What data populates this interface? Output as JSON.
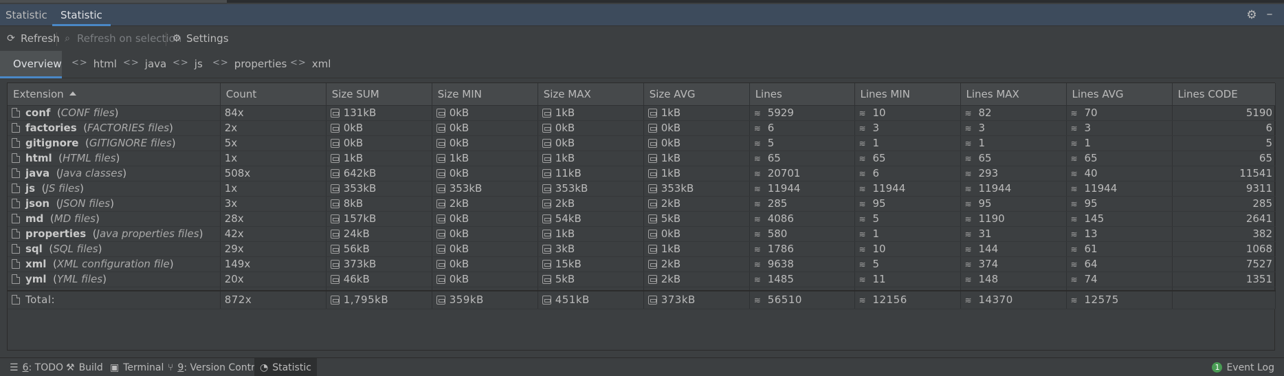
{
  "window": {
    "title": "Statistic",
    "active_tab": "Statistic"
  },
  "toolbar": {
    "refresh": "Refresh",
    "refresh_on_selection": "Refresh on selection",
    "settings": "Settings"
  },
  "subtabs": [
    "Overview",
    "html",
    "java",
    "js",
    "properties",
    "xml"
  ],
  "table": {
    "columns": [
      "Extension",
      "Count",
      "Size SUM",
      "Size MIN",
      "Size MAX",
      "Size AVG",
      "Lines",
      "Lines MIN",
      "Lines MAX",
      "Lines AVG",
      "Lines CODE"
    ],
    "rows": [
      {
        "name": "conf",
        "desc": "CONF files",
        "count": "84x",
        "size_sum": "131kB",
        "size_min": "0kB",
        "size_max": "1kB",
        "size_avg": "1kB",
        "lines": "5929",
        "lines_min": "10",
        "lines_max": "82",
        "lines_avg": "70",
        "lines_code": "5190"
      },
      {
        "name": "factories",
        "desc": "FACTORIES files",
        "count": "2x",
        "size_sum": "0kB",
        "size_min": "0kB",
        "size_max": "0kB",
        "size_avg": "0kB",
        "lines": "6",
        "lines_min": "3",
        "lines_max": "3",
        "lines_avg": "3",
        "lines_code": "6"
      },
      {
        "name": "gitignore",
        "desc": "GITIGNORE files",
        "count": "5x",
        "size_sum": "0kB",
        "size_min": "0kB",
        "size_max": "0kB",
        "size_avg": "0kB",
        "lines": "5",
        "lines_min": "1",
        "lines_max": "1",
        "lines_avg": "1",
        "lines_code": "5"
      },
      {
        "name": "html",
        "desc": "HTML files",
        "count": "1x",
        "size_sum": "1kB",
        "size_min": "1kB",
        "size_max": "1kB",
        "size_avg": "1kB",
        "lines": "65",
        "lines_min": "65",
        "lines_max": "65",
        "lines_avg": "65",
        "lines_code": "65"
      },
      {
        "name": "java",
        "desc": "Java classes",
        "count": "508x",
        "size_sum": "642kB",
        "size_min": "0kB",
        "size_max": "11kB",
        "size_avg": "1kB",
        "lines": "20701",
        "lines_min": "6",
        "lines_max": "293",
        "lines_avg": "40",
        "lines_code": "11541"
      },
      {
        "name": "js",
        "desc": "JS files",
        "count": "1x",
        "size_sum": "353kB",
        "size_min": "353kB",
        "size_max": "353kB",
        "size_avg": "353kB",
        "lines": "11944",
        "lines_min": "11944",
        "lines_max": "11944",
        "lines_avg": "11944",
        "lines_code": "9311"
      },
      {
        "name": "json",
        "desc": "JSON files",
        "count": "3x",
        "size_sum": "8kB",
        "size_min": "2kB",
        "size_max": "2kB",
        "size_avg": "2kB",
        "lines": "285",
        "lines_min": "95",
        "lines_max": "95",
        "lines_avg": "95",
        "lines_code": "285"
      },
      {
        "name": "md",
        "desc": "MD files",
        "count": "28x",
        "size_sum": "157kB",
        "size_min": "0kB",
        "size_max": "54kB",
        "size_avg": "5kB",
        "lines": "4086",
        "lines_min": "5",
        "lines_max": "1190",
        "lines_avg": "145",
        "lines_code": "2641"
      },
      {
        "name": "properties",
        "desc": "Java properties files",
        "count": "42x",
        "size_sum": "24kB",
        "size_min": "0kB",
        "size_max": "1kB",
        "size_avg": "0kB",
        "lines": "580",
        "lines_min": "1",
        "lines_max": "31",
        "lines_avg": "13",
        "lines_code": "382"
      },
      {
        "name": "sql",
        "desc": "SQL files",
        "count": "29x",
        "size_sum": "56kB",
        "size_min": "0kB",
        "size_max": "3kB",
        "size_avg": "1kB",
        "lines": "1786",
        "lines_min": "10",
        "lines_max": "144",
        "lines_avg": "61",
        "lines_code": "1068"
      },
      {
        "name": "xml",
        "desc": "XML configuration file",
        "count": "149x",
        "size_sum": "373kB",
        "size_min": "0kB",
        "size_max": "15kB",
        "size_avg": "2kB",
        "lines": "9638",
        "lines_min": "5",
        "lines_max": "374",
        "lines_avg": "64",
        "lines_code": "7527"
      },
      {
        "name": "yml",
        "desc": "YML files",
        "count": "20x",
        "size_sum": "46kB",
        "size_min": "0kB",
        "size_max": "5kB",
        "size_avg": "2kB",
        "lines": "1485",
        "lines_min": "11",
        "lines_max": "148",
        "lines_avg": "74",
        "lines_code": "1351"
      }
    ],
    "total": {
      "label": "Total:",
      "count": "872x",
      "size_sum": "1,795kB",
      "size_min": "359kB",
      "size_max": "451kB",
      "size_avg": "373kB",
      "lines": "56510",
      "lines_min": "12156",
      "lines_max": "14370",
      "lines_avg": "12575",
      "lines_code": ""
    }
  },
  "bottombar": {
    "todo_num": "6",
    "todo": ": TODO",
    "build": "Build",
    "terminal": "Terminal",
    "vc_num": "9",
    "vc": ": Version Control",
    "statistic": "Statistic",
    "event_count": "1",
    "event_log": "Event Log"
  },
  "colors": {
    "accent": "#4a88c7",
    "header_bg": "#3d4b5c",
    "panel_bg": "#3c3f41",
    "event_badge": "#499c54"
  }
}
